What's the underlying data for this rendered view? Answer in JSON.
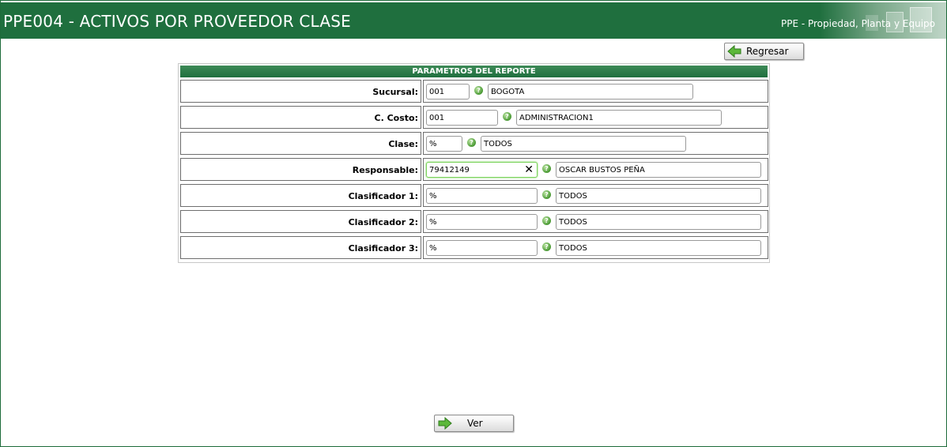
{
  "header": {
    "title": "PPE004 - ACTIVOS POR PROVEEDOR CLASE",
    "module": "PPE - Propiedad, Planta y Equipo"
  },
  "buttons": {
    "back_label": "Regresar",
    "view_label": "Ver"
  },
  "params": {
    "title": "PARAMETROS DEL REPORTE",
    "rows": [
      {
        "label": "Sucursal:",
        "code": "001",
        "description": "BOGOTA"
      },
      {
        "label": "C. Costo:",
        "code": "001",
        "description": "ADMINISTRACION1"
      },
      {
        "label": "Clase:",
        "code": "%",
        "description": "TODOS"
      },
      {
        "label": "Responsable:",
        "code": "79412149",
        "description": "OSCAR BUSTOS PEÑA"
      },
      {
        "label": "Clasificador 1:",
        "code": "%",
        "description": "TODOS"
      },
      {
        "label": "Clasificador 2:",
        "code": "%",
        "description": "TODOS"
      },
      {
        "label": "Clasificador 3:",
        "code": "%",
        "description": "TODOS"
      }
    ]
  },
  "icons": {
    "help": "help-icon",
    "clear": "clear-icon",
    "back": "arrow-left-icon",
    "view": "arrow-right-icon"
  },
  "colors": {
    "header_green": "#1f6f3e",
    "help_green": "#4a9a34",
    "focus_green": "#7ad35a"
  }
}
